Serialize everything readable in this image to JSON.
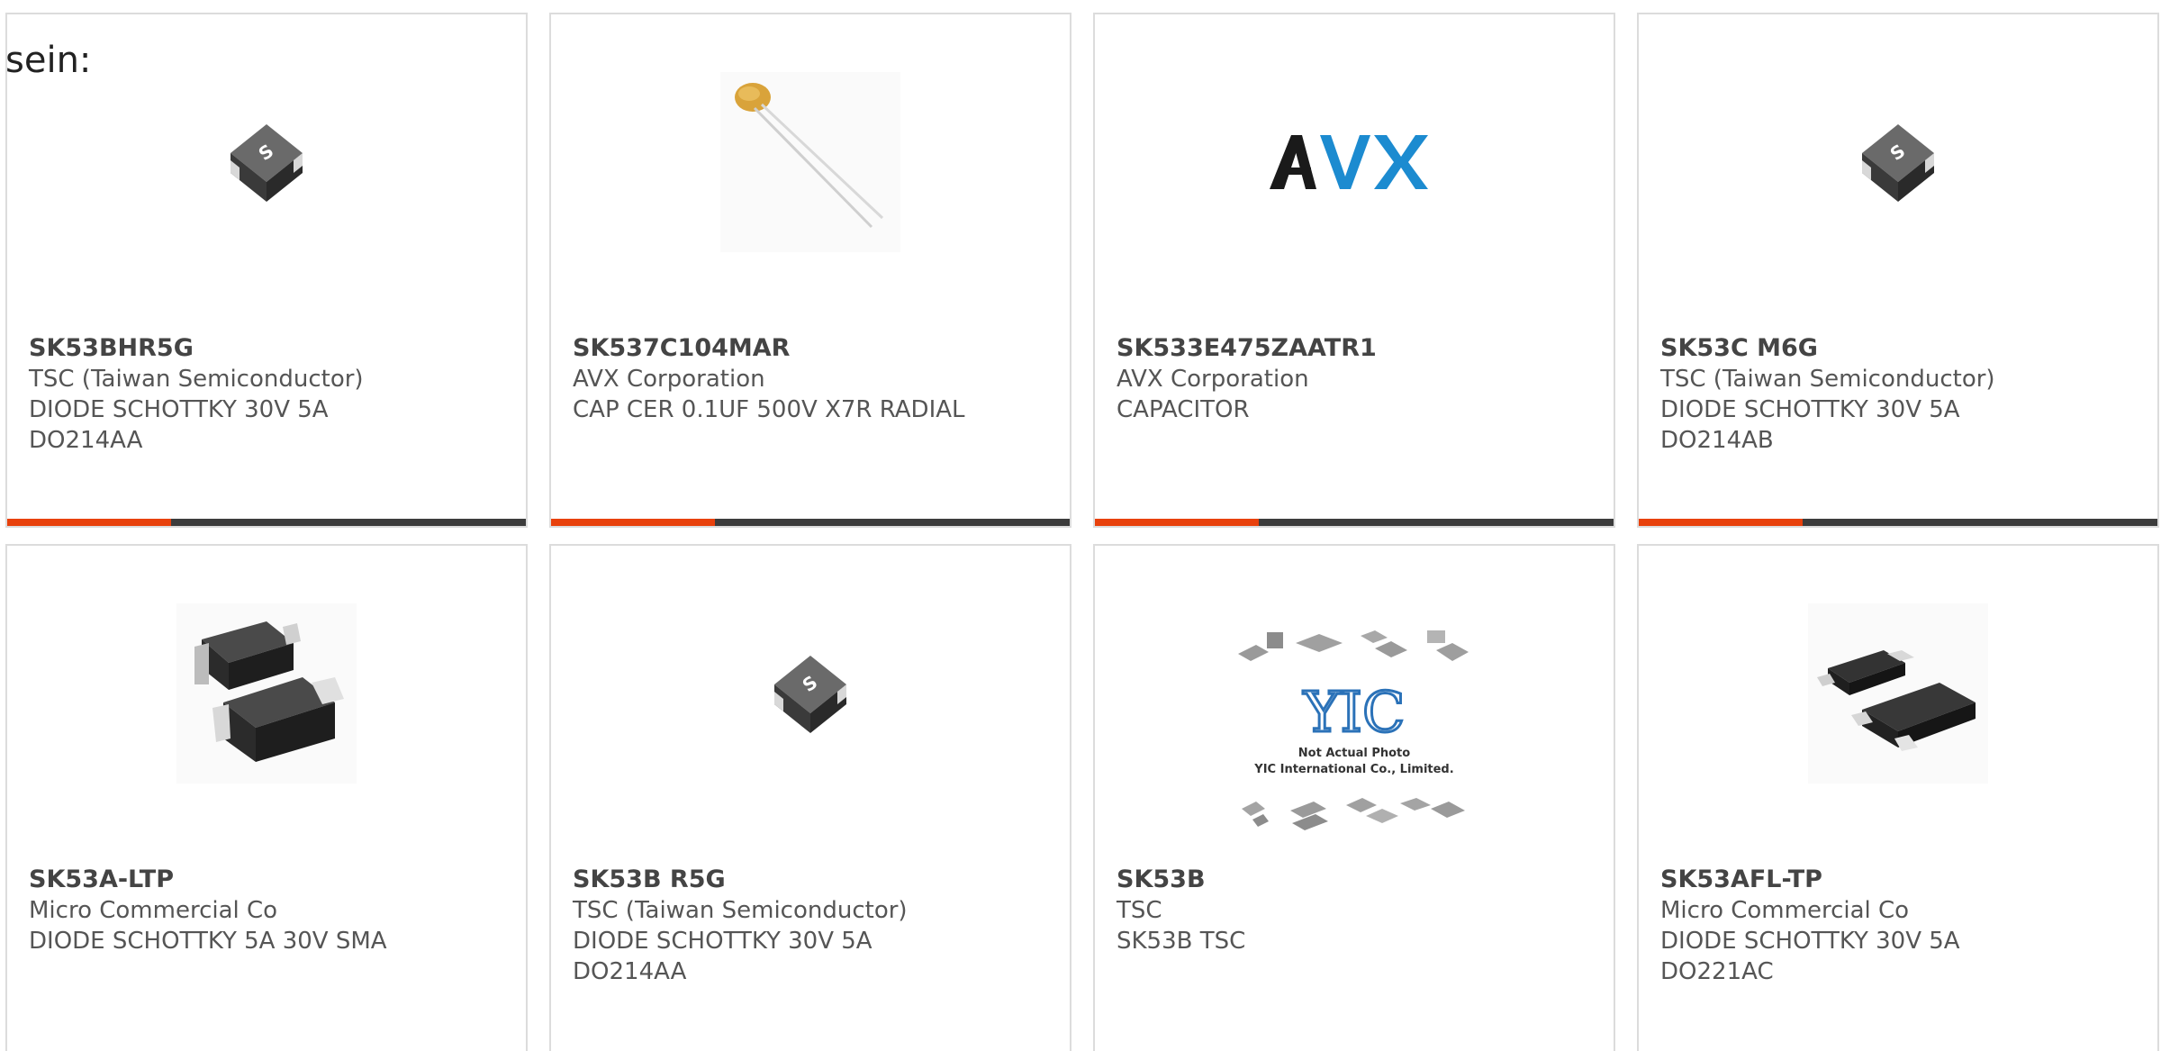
{
  "lead_text": "sein:",
  "colors": {
    "accent": "#e8410c",
    "bar": "#3c3c3c",
    "border": "#dcdcdc",
    "text": "#555555"
  },
  "products": [
    {
      "part": "SK53BHR5G",
      "manufacturer": "TSC (Taiwan Semiconductor)",
      "desc1": "DIODE SCHOTTKY 30V 5A",
      "desc2": "DO214AA",
      "image": "smd-diode-package-icon"
    },
    {
      "part": "SK537C104MAR",
      "manufacturer": "AVX Corporation",
      "desc1": "CAP CER 0.1UF 500V X7R RADIAL",
      "desc2": "",
      "image": "radial-capacitor-icon"
    },
    {
      "part": "SK533E475ZAATR1",
      "manufacturer": "AVX Corporation",
      "desc1": "CAPACITOR",
      "desc2": "",
      "image": "avx-logo",
      "logo_text": "AVX"
    },
    {
      "part": "SK53C M6G",
      "manufacturer": "TSC (Taiwan Semiconductor)",
      "desc1": "DIODE SCHOTTKY 30V 5A",
      "desc2": "DO214AB",
      "image": "smd-diode-package-icon"
    },
    {
      "part": "SK53A-LTP",
      "manufacturer": "Micro Commercial Co",
      "desc1": "DIODE SCHOTTKY 5A 30V SMA",
      "desc2": "",
      "image": "sma-package-icon"
    },
    {
      "part": "SK53B R5G",
      "manufacturer": "TSC (Taiwan Semiconductor)",
      "desc1": "DIODE SCHOTTKY 30V 5A",
      "desc2": "DO214AA",
      "image": "smd-diode-package-icon"
    },
    {
      "part": "SK53B",
      "manufacturer": "TSC",
      "desc1": "SK53B TSC",
      "desc2": "",
      "image": "not-actual-photo-placeholder",
      "placeholder_logo": "YIC",
      "placeholder_line1": "Not Actual Photo",
      "placeholder_line2": "YIC International Co., Limited."
    },
    {
      "part": "SK53AFL-TP",
      "manufacturer": "Micro Commercial Co",
      "desc1": "DIODE SCHOTTKY 30V 5A",
      "desc2": "DO221AC",
      "image": "flat-lead-package-icon"
    }
  ]
}
